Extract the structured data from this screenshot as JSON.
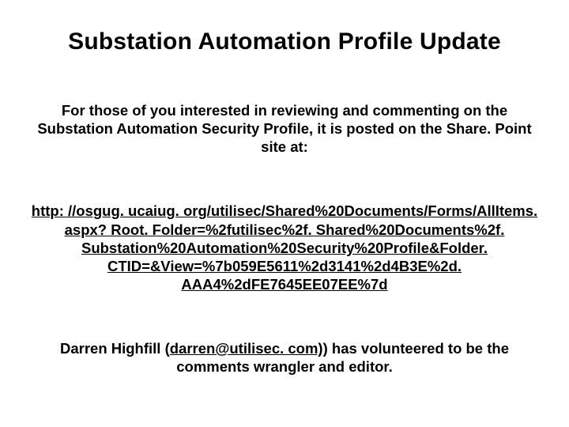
{
  "title": "Substation Automation Profile Update",
  "intro": "For those of you interested in reviewing and commenting on the Substation Automation Security Profile, it is posted on the Share. Point site at:",
  "link_text": "http: //osgug. ucaiug. org/utilisec/Shared%20Documents/Forms/AllItems. aspx? Root. Folder=%2futilisec%2f. Shared%20Documents%2f. Substation%20Automation%20Security%20Profile&Folder. CTID=&View=%7b059E5611%2d3141%2d4B3E%2d. AAA4%2dFE7645EE07EE%7d",
  "footer_prefix": "Darren Highfill (",
  "footer_email": "darren@utilisec. com)",
  "footer_suffix": ") has volunteered to be the comments wrangler and editor."
}
